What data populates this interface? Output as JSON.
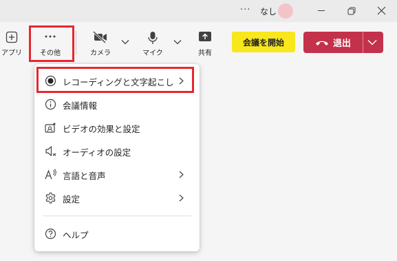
{
  "titlebar": {
    "more": "···",
    "user_name": "なし"
  },
  "toolbar": {
    "apps_label": "アプリ",
    "more_label": "その他",
    "camera_label": "カメラ",
    "mic_label": "マイク",
    "share_label": "共有",
    "start_meeting_label": "会議を開始",
    "leave_label": "退出"
  },
  "menu": {
    "items": [
      {
        "label": "レコーディングと文字起こし",
        "icon": "record-icon",
        "has_submenu": true
      },
      {
        "label": "会議情報",
        "icon": "info-icon",
        "has_submenu": false
      },
      {
        "label": "ビデオの効果と設定",
        "icon": "video-effects-icon",
        "has_submenu": false
      },
      {
        "label": "オーディオの設定",
        "icon": "speaker-icon",
        "has_submenu": false
      },
      {
        "label": "言語と音声",
        "icon": "language-icon",
        "has_submenu": true
      },
      {
        "label": "設定",
        "icon": "gear-icon",
        "has_submenu": true
      },
      {
        "label": "ヘルプ",
        "icon": "help-icon",
        "has_submenu": false
      }
    ]
  },
  "colors": {
    "highlight": "#e8262e",
    "start_button": "#f8e71c",
    "leave_button": "#c4314b",
    "avatar": "#f3c4c7"
  }
}
